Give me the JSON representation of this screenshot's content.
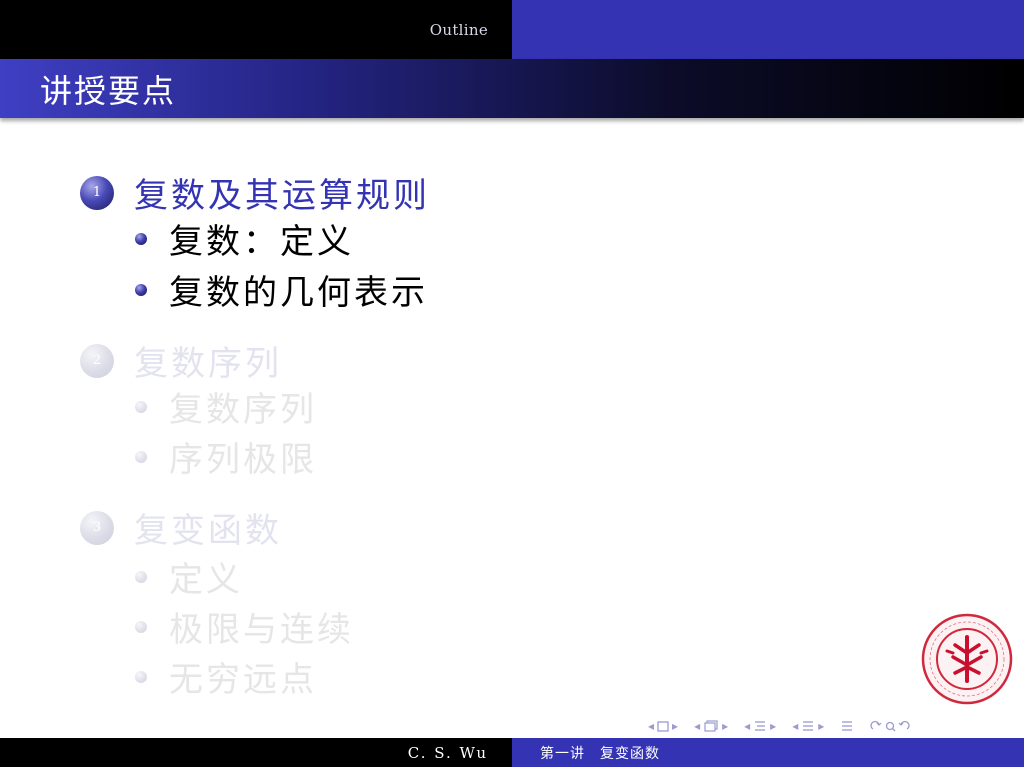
{
  "headline": {
    "section": "Outline"
  },
  "frame": {
    "title": "讲授要点"
  },
  "toc": {
    "sections": [
      {
        "number": "1",
        "title": "复数及其运算规则",
        "state": "current",
        "subsections": [
          "复数：定义",
          "复数的几何表示"
        ]
      },
      {
        "number": "2",
        "title": "复数序列",
        "state": "faded",
        "subsections": [
          "复数序列",
          "序列极限"
        ]
      },
      {
        "number": "3",
        "title": "复变函数",
        "state": "faded",
        "subsections": [
          "定义",
          "极限与连续",
          "无穷远点"
        ]
      }
    ]
  },
  "footer": {
    "author": "C. S. Wu",
    "lecture": "第一讲　复变函数"
  },
  "colors": {
    "beamer_blue": "#3333b3",
    "faded_text": "#e3e3f0",
    "logo_red": "#c8102e"
  },
  "icons": {
    "logo": "peking-university-seal-icon",
    "nav": [
      "nav-slide-icon",
      "nav-frame-icon",
      "nav-subsection-icon",
      "nav-section-icon",
      "nav-document-icon",
      "nav-search-icon"
    ]
  }
}
